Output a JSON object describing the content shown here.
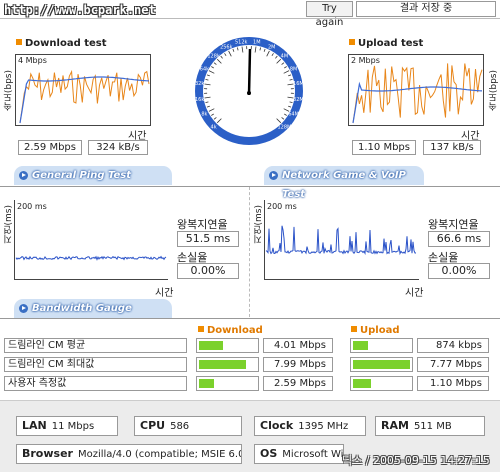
{
  "header": {
    "site_url": "http://www.bcpark.net",
    "try_again_label": "Try again",
    "save_result_label": "결과 저장 중"
  },
  "download": {
    "title": "Download test",
    "ylabel": "속도(bps)",
    "scale_label": "4 Mbps",
    "xlabel": "시간",
    "mbps": "2.59 Mbps",
    "kbs": "324 kB/s"
  },
  "upload": {
    "title": "Upload test",
    "ylabel": "속도(bps)",
    "scale_label": "2 Mbps",
    "xlabel": "시간",
    "mbps": "1.10 Mbps",
    "kbs": "137 kB/s"
  },
  "gauge": {
    "labels": [
      "4k",
      "8k",
      "16k",
      "32k",
      "64k",
      "128k",
      "256k",
      "512k",
      "1M",
      "2M",
      "4M",
      "8M",
      "16M",
      "32M",
      "64M",
      "128M"
    ],
    "needle_value": "2.59 Mbps"
  },
  "general_ping": {
    "banner": "General Ping Test",
    "scale_label": "200 ms",
    "ylabel": "지연(ms)",
    "xlabel": "시간",
    "rtt_label": "왕복지연율",
    "rtt_value": "51.5 ms",
    "loss_label": "손실율",
    "loss_value": "0.00%"
  },
  "game_voip": {
    "banner": "Network Game & VoIP Test",
    "scale_label": "200 ms",
    "ylabel": "지연(ms)",
    "xlabel": "시간",
    "rtt_label": "왕복지연율",
    "rtt_value": "66.6 ms",
    "loss_label": "손실율",
    "loss_value": "0.00%"
  },
  "bandwidth": {
    "banner": "Bandwidth Gauge",
    "download_header": "Download",
    "upload_header": "Upload",
    "rows": [
      {
        "label": "드림라인 CM 평균",
        "dl_value": "4.01 Mbps",
        "dl_fraction": 0.4,
        "ul_value": "874 kbps",
        "ul_fraction": 0.25
      },
      {
        "label": "드림라인 CM 최대값",
        "dl_value": "7.99 Mbps",
        "dl_fraction": 0.8,
        "ul_value": "7.77 Mbps",
        "ul_fraction": 0.97
      },
      {
        "label": "사용자 측정값",
        "dl_value": "2.59 Mbps",
        "dl_fraction": 0.26,
        "ul_value": "1.10 Mbps",
        "ul_fraction": 0.3
      }
    ]
  },
  "system_info": {
    "lan_label": "LAN",
    "lan_value": "11 Mbps",
    "cpu_label": "CPU",
    "cpu_value": "586",
    "clock_label": "Clock",
    "clock_value": "1395 MHz",
    "ram_label": "RAM",
    "ram_value": "511 MB",
    "browser_label": "Browser",
    "browser_value": "Mozilla/4.0 (compatible; MSIE 6.0",
    "os_label": "OS",
    "os_value": "Microsoft Win",
    "timestamp": "딕스 / 2005-09-15 14:27:15"
  },
  "colors": {
    "download_line": "#e8861a",
    "average_line": "#3d6bd6",
    "ping_line": "#2a52c8",
    "bar_fill": "#7bd12c",
    "banner_bg": "#cfe0f4",
    "title_square": "#f08c00"
  }
}
